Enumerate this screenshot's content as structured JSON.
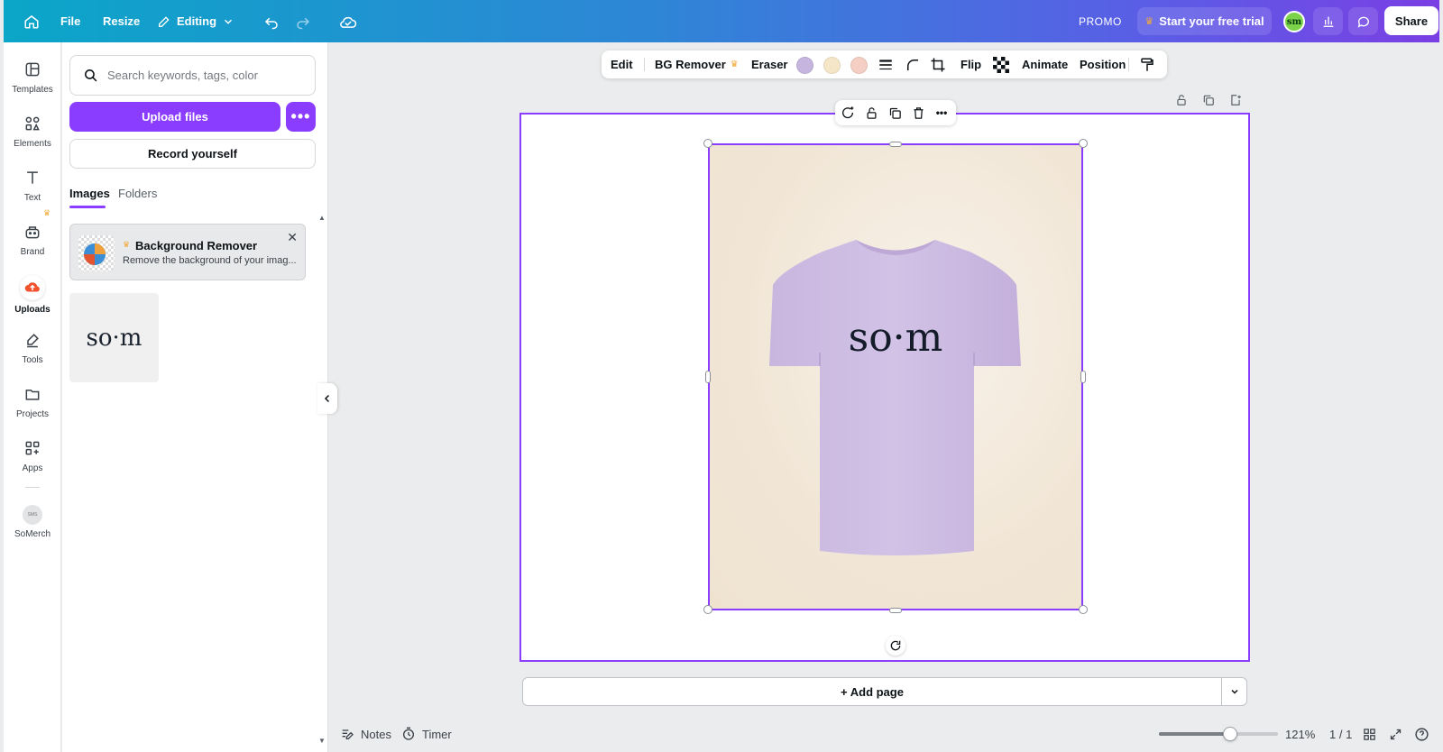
{
  "topbar": {
    "file": "File",
    "resize": "Resize",
    "editing": "Editing",
    "promo": "PROMO",
    "trial": "Start your free trial",
    "avatar_initials": "sm",
    "share": "Share"
  },
  "rail": {
    "items": [
      {
        "label": "Templates",
        "icon": "templates-icon"
      },
      {
        "label": "Elements",
        "icon": "elements-icon"
      },
      {
        "label": "Text",
        "icon": "text-icon"
      },
      {
        "label": "Brand",
        "icon": "brand-icon"
      },
      {
        "label": "Uploads",
        "icon": "uploads-icon"
      },
      {
        "label": "Tools",
        "icon": "tools-icon"
      },
      {
        "label": "Projects",
        "icon": "projects-icon"
      },
      {
        "label": "Apps",
        "icon": "apps-icon"
      },
      {
        "label": "SoMerch",
        "icon": "somerch-icon"
      }
    ],
    "active": "Uploads"
  },
  "panel": {
    "search_placeholder": "Search keywords, tags, color",
    "upload_label": "Upload files",
    "record_label": "Record yourself",
    "tabs": [
      "Images",
      "Folders"
    ],
    "active_tab": "Images",
    "promo": {
      "title": "Background Remover",
      "description": "Remove the background of your imag..."
    },
    "upload_thumb_text": "so·m"
  },
  "context_toolbar": {
    "edit": "Edit",
    "bg_remover": "BG Remover",
    "eraser": "Eraser",
    "swatches": [
      "#c6b6df",
      "#f6e6c8",
      "#f6cfc4"
    ],
    "flip": "Flip",
    "animate": "Animate",
    "position": "Position"
  },
  "canvas": {
    "design_text": "so·m",
    "shirt_color": "#cbb9e0",
    "background_color": "#f1e6d6",
    "add_page": "+ Add page"
  },
  "bottombar": {
    "notes": "Notes",
    "timer": "Timer",
    "zoom": "121%",
    "zoom_fraction": 0.6,
    "pages": "1 / 1"
  },
  "colors": {
    "accent": "#8b3dff",
    "premium_crown": "#f2a93b"
  }
}
